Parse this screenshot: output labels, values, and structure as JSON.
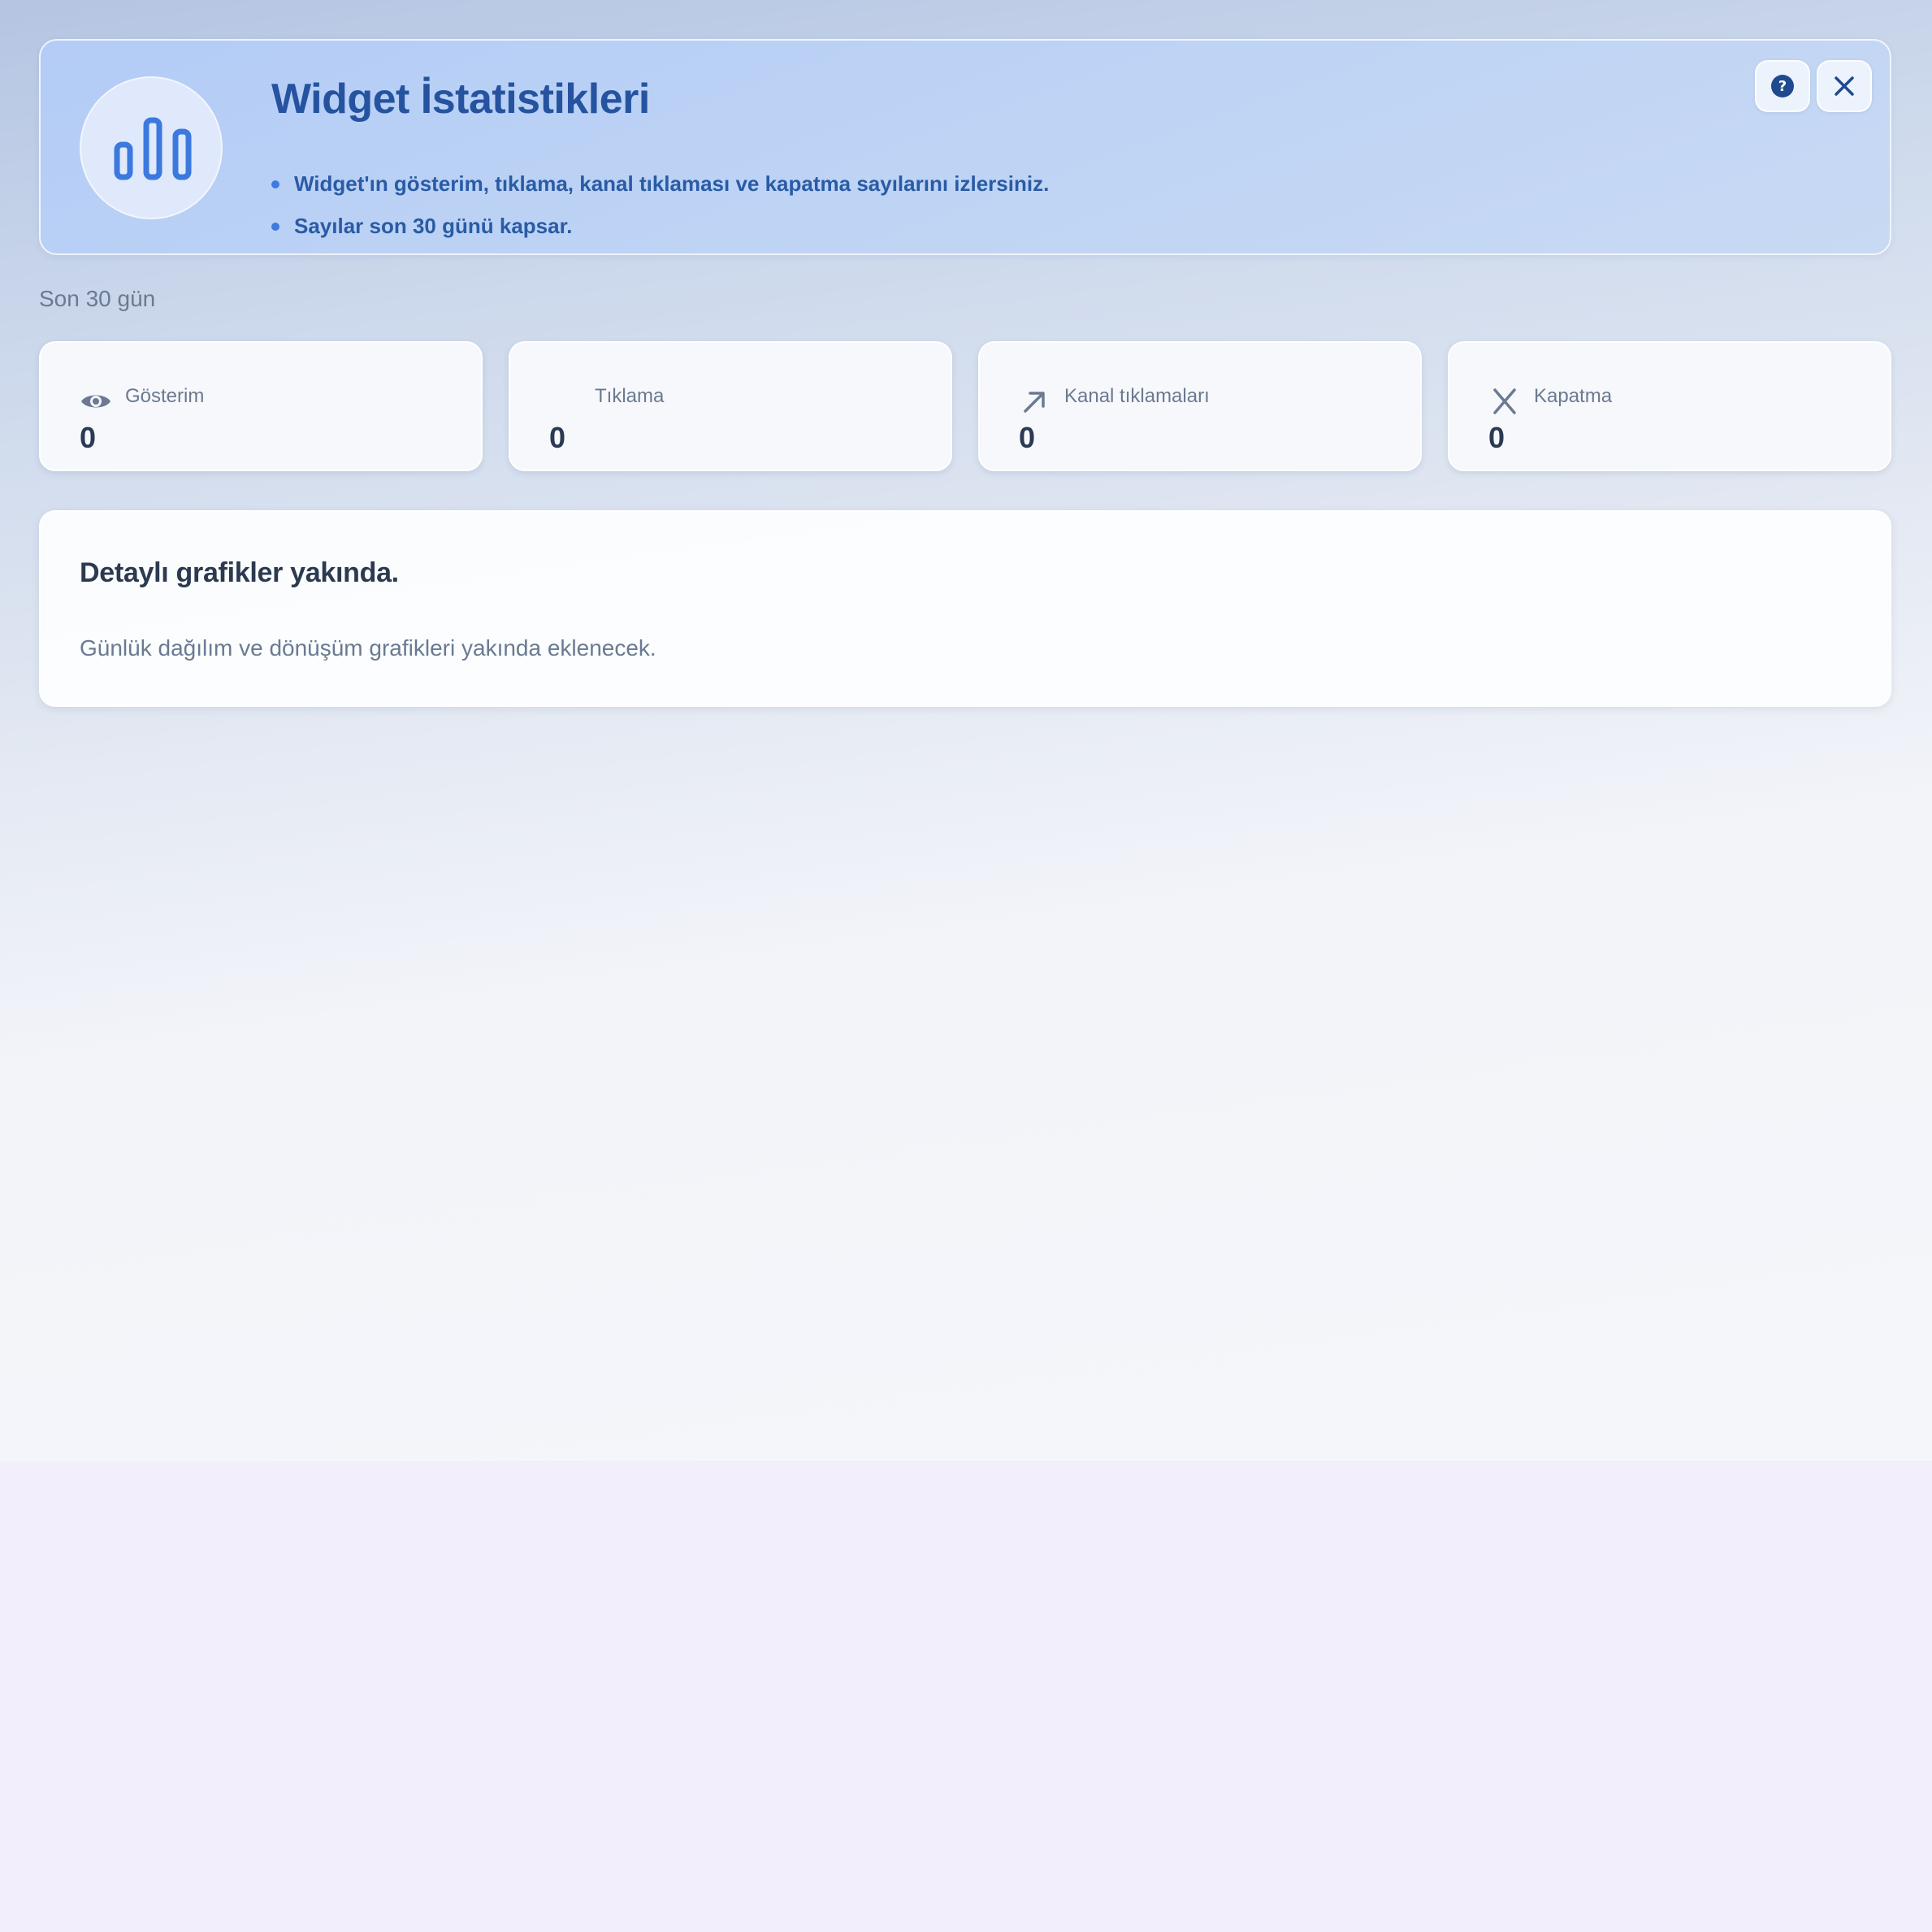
{
  "header": {
    "title": "Widget İstatistikleri",
    "bullets": [
      "Widget'ın gösterim, tıklama, kanal tıklaması ve kapatma sayılarını izlersiniz.",
      "Sayılar son 30 günü kapsar."
    ],
    "logo_icon": "bar-chart-icon",
    "help_icon": "help-icon",
    "close_icon": "close-icon",
    "accent_color": "#2653a0"
  },
  "period_label": "Son 30 gün",
  "stats": [
    {
      "label": "Gösterim",
      "value": "0",
      "icon": "eye-icon"
    },
    {
      "label": "Tıklama",
      "value": "0",
      "icon": ""
    },
    {
      "label": "Kanal tıklamaları",
      "value": "0",
      "icon": "arrow-up-right-icon"
    },
    {
      "label": "Kapatma",
      "value": "0",
      "icon": "x-icon"
    }
  ],
  "details": {
    "title": "Detaylı grafikler yakında.",
    "description": "Günlük dağılım ve dönüşüm grafikleri yakında eklenecek."
  }
}
